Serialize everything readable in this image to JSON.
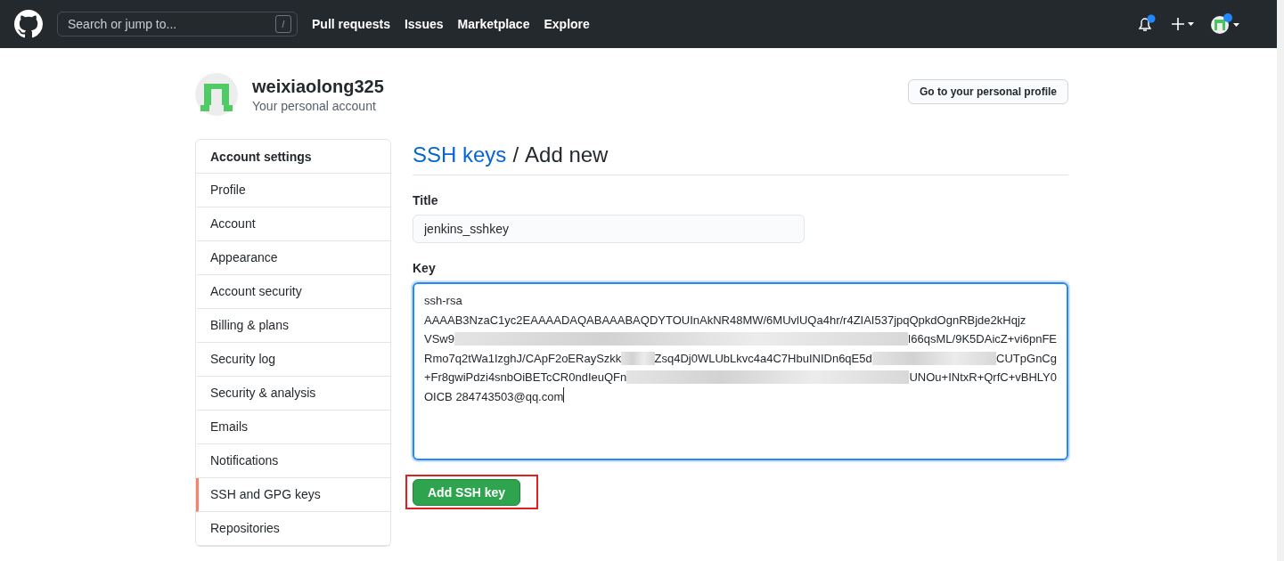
{
  "header": {
    "search": {
      "placeholder": "Search or jump to...",
      "shortcut": "/"
    },
    "nav": [
      "Pull requests",
      "Issues",
      "Marketplace",
      "Explore"
    ],
    "notifications_unread": true
  },
  "account": {
    "name": "weixiaolong325",
    "subtitle": "Your personal account",
    "profile_button": "Go to your personal profile"
  },
  "sidebar": {
    "heading": "Account settings",
    "items": [
      {
        "label": "Profile",
        "selected": false
      },
      {
        "label": "Account",
        "selected": false
      },
      {
        "label": "Appearance",
        "selected": false
      },
      {
        "label": "Account security",
        "selected": false
      },
      {
        "label": "Billing & plans",
        "selected": false
      },
      {
        "label": "Security log",
        "selected": false
      },
      {
        "label": "Security & analysis",
        "selected": false
      },
      {
        "label": "Emails",
        "selected": false
      },
      {
        "label": "Notifications",
        "selected": false
      },
      {
        "label": "SSH and GPG keys",
        "selected": true
      },
      {
        "label": "Repositories",
        "selected": false
      }
    ]
  },
  "page": {
    "breadcrumb_link": "SSH keys",
    "separator": "/",
    "heading": "Add new"
  },
  "form": {
    "title_label": "Title",
    "title_value": "jenkins_sshkey",
    "key_label": "Key",
    "key_lines": [
      {
        "segments": [
          "ssh-rsa"
        ]
      },
      {
        "segments": [
          "AAAAB3NzaC1yc2EAAAADAQABAAABAQDYTOUInAkNR48MW/6MUvlUQa4hr/r4ZIAI537jpqQpkdOgnRBjde2kHqjz"
        ]
      },
      {
        "segments": [
          "VSw9",
          "I66qsML/9K5DAicZ+vi6pnFE"
        ]
      },
      {
        "segments": [
          "Rmo7q2tWa1IzghJ/CApF2oERaySzkk",
          "Zsq4Dj0WLUbLkvc4a4C7HbuINIDn6qE5d",
          "CUTpGnCg"
        ]
      },
      {
        "segments": [
          "+Fr8gwiPdzi4snbOiBETcCR0ndIeuQFn",
          "UNOu+INtxR+QrfC+vBHLY0"
        ]
      },
      {
        "segments": [
          "OICB 284743503@qq.com"
        ]
      }
    ],
    "submit": "Add SSH key"
  }
}
